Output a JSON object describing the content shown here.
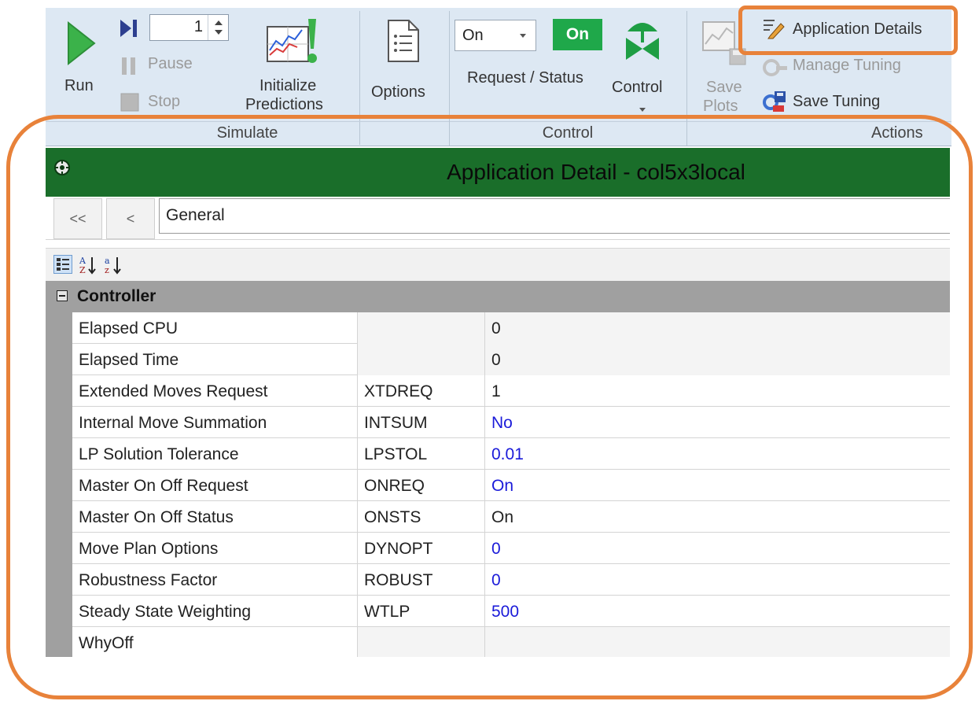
{
  "ribbon": {
    "run_label": "Run",
    "step_value": "1",
    "pause_label": "Pause",
    "stop_label": "Stop",
    "initialize_label_1": "Initialize",
    "initialize_label_2": "Predictions",
    "options_label": "Options",
    "request_value": "On",
    "status_badge": "On",
    "request_status_label": "Request / Status",
    "control_label": "Control",
    "save_plots_label_1": "Save",
    "save_plots_label_2": "Plots",
    "application_details_label": "Application Details",
    "manage_tuning_label": "Manage Tuning",
    "save_tuning_label": "Save Tuning",
    "groups": [
      "Simulate",
      "Control",
      "Actions"
    ]
  },
  "panel": {
    "title": "Application Detail - col5x3local",
    "nav_first": "<<",
    "nav_prev": "<",
    "current_page": "General",
    "category": "Controller",
    "rows": [
      {
        "name": "Elapsed CPU",
        "code": "",
        "value": "0",
        "editable": false
      },
      {
        "name": "Elapsed Time",
        "code": "",
        "value": "0",
        "editable": false
      },
      {
        "name": "Extended Moves Request",
        "code": "XTDREQ",
        "value": "1",
        "editable": false
      },
      {
        "name": "Internal Move Summation",
        "code": "INTSUM",
        "value": "No",
        "editable": true
      },
      {
        "name": "LP Solution Tolerance",
        "code": "LPSTOL",
        "value": "0.01",
        "editable": true
      },
      {
        "name": "Master On Off Request",
        "code": "ONREQ",
        "value": "On",
        "editable": true
      },
      {
        "name": "Master On Off Status",
        "code": "ONSTS",
        "value": "On",
        "editable": false
      },
      {
        "name": "Move Plan Options",
        "code": "DYNOPT",
        "value": "0",
        "editable": true
      },
      {
        "name": "Robustness Factor",
        "code": "ROBUST",
        "value": "0",
        "editable": true
      },
      {
        "name": "Steady State Weighting",
        "code": "WTLP",
        "value": "500",
        "editable": true
      },
      {
        "name": "WhyOff",
        "code": "",
        "value": "",
        "editable": false
      }
    ]
  },
  "colors": {
    "highlight": "#e8823a",
    "titlebar": "#1a6e2a",
    "status_on": "#1fa84a",
    "editable_value": "#1a1ad9"
  },
  "icons": [
    "run-icon",
    "step-icon",
    "pause-icon",
    "stop-icon",
    "initialize-predictions-icon",
    "options-icon",
    "control-valve-icon",
    "save-plots-icon",
    "application-details-icon",
    "manage-tuning-icon",
    "save-tuning-icon",
    "pin-icon",
    "categorized-icon",
    "sort-az-icon",
    "sort-za-icon"
  ]
}
